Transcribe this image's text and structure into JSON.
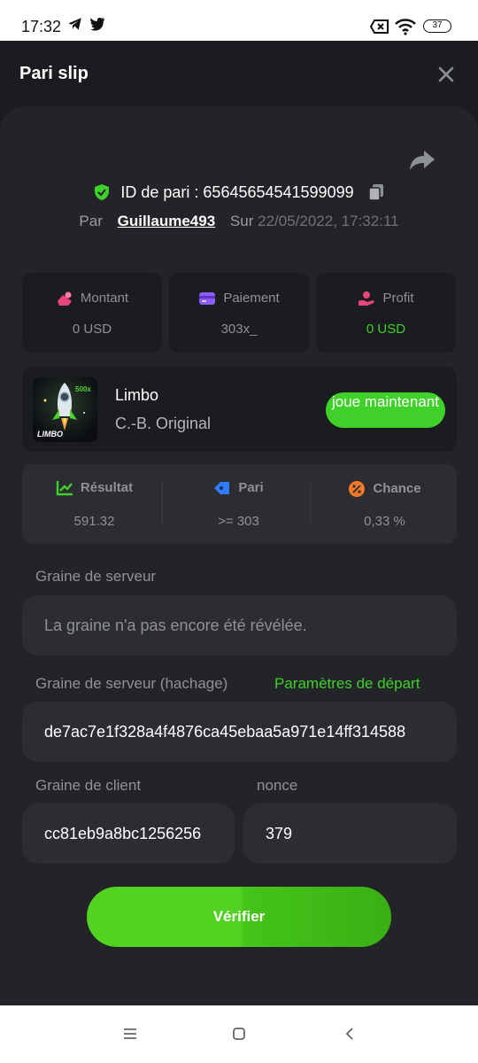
{
  "status_bar": {
    "time": "17:32",
    "battery": "37",
    "icons": [
      "telegram-icon",
      "twitter-icon",
      "sim-off-icon",
      "wifi-icon",
      "battery-icon"
    ]
  },
  "header": {
    "title": "Pari slip",
    "close_icon": "close-icon"
  },
  "bet": {
    "id_label": "ID de pari : 65645654541599099",
    "by_label": "Par",
    "username": "Guillaume493",
    "on_label": "Sur",
    "date": "22/05/2022, 17:32:11"
  },
  "stats": [
    {
      "label": "Montant",
      "value": "0 USD",
      "icon": "money-icon"
    },
    {
      "label": "Paiement",
      "value": "303x_",
      "icon": "card-icon"
    },
    {
      "label": "Profit",
      "value": "0 USD",
      "icon": "profit-hand-icon"
    }
  ],
  "game": {
    "name": "Limbo",
    "provider": "C.-B. Original",
    "thumb_text": "LIMBO",
    "thumb_badge": "500x",
    "play_label": "joue maintenant"
  },
  "results": [
    {
      "label": "Résultat",
      "value": "591.32",
      "icon": "result-chart-icon"
    },
    {
      "label": "Pari",
      "value": ">= 303",
      "icon": "bet-tag-icon"
    },
    {
      "label": "Chance",
      "value": "0,33 %",
      "icon": "percent-icon"
    }
  ],
  "fairness": {
    "server_seed_label": "Graine de serveur",
    "server_seed_value": "La graine n'a pas encore été révélée.",
    "server_hash_label": "Graine de serveur (hachage)",
    "start_params_link": "Paramètres de départ",
    "server_hash_value": "de7ac7e1f328a4f4876ca45ebaa5a971e14ff314588",
    "client_seed_label": "Graine de client",
    "client_seed_value": "cc81eb9a8bc1256256",
    "nonce_label": "nonce",
    "nonce_value": "379"
  },
  "verify_label": "Vérifier",
  "colors": {
    "accent_green": "#3fd12a",
    "background": "#1b1c1f",
    "panel": "#232428"
  }
}
